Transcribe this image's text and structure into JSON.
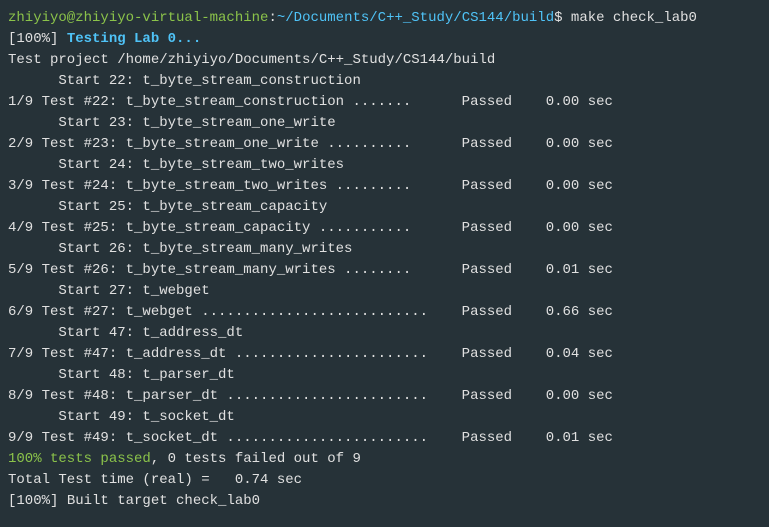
{
  "prompt": {
    "user": "zhiyiyo@zhiyiyo-virtual-machine",
    "sep": ":",
    "path": "~/Documents/C++_Study/CS144/build",
    "sym": "$",
    "command": "make check_lab0"
  },
  "progress_open": "[100%] ",
  "testing_label": "Testing Lab 0...",
  "project_line": "Test project /home/zhiyiyo/Documents/C++_Study/CS144/build",
  "tests": [
    {
      "start_num": "22",
      "start_name": "t_byte_stream_construction",
      "idx": "1/9",
      "num": "#22",
      "name": "t_byte_stream_construction",
      "dots": ".......",
      "status": "Passed",
      "time": "0.00",
      "unit": "sec"
    },
    {
      "start_num": "23",
      "start_name": "t_byte_stream_one_write",
      "idx": "2/9",
      "num": "#23",
      "name": "t_byte_stream_one_write",
      "dots": "..........",
      "status": "Passed",
      "time": "0.00",
      "unit": "sec"
    },
    {
      "start_num": "24",
      "start_name": "t_byte_stream_two_writes",
      "idx": "3/9",
      "num": "#24",
      "name": "t_byte_stream_two_writes",
      "dots": ".........",
      "status": "Passed",
      "time": "0.00",
      "unit": "sec"
    },
    {
      "start_num": "25",
      "start_name": "t_byte_stream_capacity",
      "idx": "4/9",
      "num": "#25",
      "name": "t_byte_stream_capacity",
      "dots": "...........",
      "status": "Passed",
      "time": "0.00",
      "unit": "sec"
    },
    {
      "start_num": "26",
      "start_name": "t_byte_stream_many_writes",
      "idx": "5/9",
      "num": "#26",
      "name": "t_byte_stream_many_writes",
      "dots": "........",
      "status": "Passed",
      "time": "0.01",
      "unit": "sec"
    },
    {
      "start_num": "27",
      "start_name": "t_webget",
      "idx": "6/9",
      "num": "#27",
      "name": "t_webget",
      "dots": "...........................",
      "status": "Passed",
      "time": "0.66",
      "unit": "sec"
    },
    {
      "start_num": "47",
      "start_name": "t_address_dt",
      "idx": "7/9",
      "num": "#47",
      "name": "t_address_dt",
      "dots": ".......................",
      "status": "Passed",
      "time": "0.04",
      "unit": "sec"
    },
    {
      "start_num": "48",
      "start_name": "t_parser_dt",
      "idx": "8/9",
      "num": "#48",
      "name": "t_parser_dt",
      "dots": "........................",
      "status": "Passed",
      "time": "0.00",
      "unit": "sec"
    },
    {
      "start_num": "49",
      "start_name": "t_socket_dt",
      "idx": "9/9",
      "num": "#49",
      "name": "t_socket_dt",
      "dots": "........................",
      "status": "Passed",
      "time": "0.01",
      "unit": "sec"
    }
  ],
  "summary": {
    "passed": "100% tests passed",
    "failed": ", 0 tests failed out of 9"
  },
  "total_time": "Total Test time (real) =   0.74 sec",
  "built_open": "[100%] ",
  "built_target": "Built target check_lab0"
}
